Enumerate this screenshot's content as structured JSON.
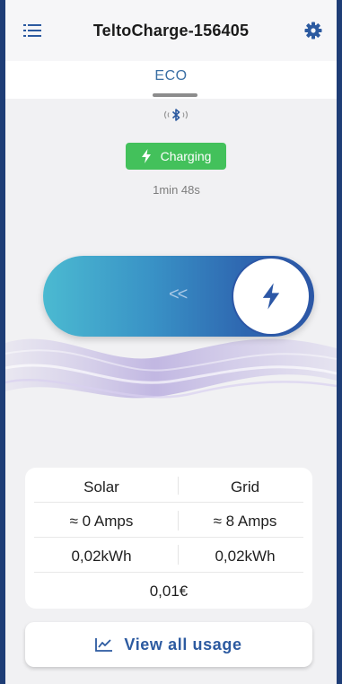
{
  "header": {
    "title": "TeltoCharge-156405",
    "menu_icon": "list-icon",
    "settings_icon": "gear-icon"
  },
  "mode": {
    "label": "ECO",
    "connection_icon": "bluetooth-icon"
  },
  "status": {
    "label": "Charging",
    "icon": "lightning-bolt-icon",
    "elapsed": "1min 48s"
  },
  "slider": {
    "arrows": "<<",
    "knob_icon": "lightning-bolt-icon"
  },
  "usage": {
    "solar_label": "Solar",
    "grid_label": "Grid",
    "solar_current": "≈ 0 Amps",
    "grid_current": "≈ 8 Amps",
    "solar_energy": "0,02kWh",
    "grid_energy": "0,02kWh",
    "cost": "0,01€"
  },
  "view_usage": {
    "label": "View all usage",
    "icon": "line-chart-icon"
  },
  "colors": {
    "brand_blue": "#2c57a6",
    "charging_green": "#43c15b",
    "frame_border": "#1e3d76"
  }
}
